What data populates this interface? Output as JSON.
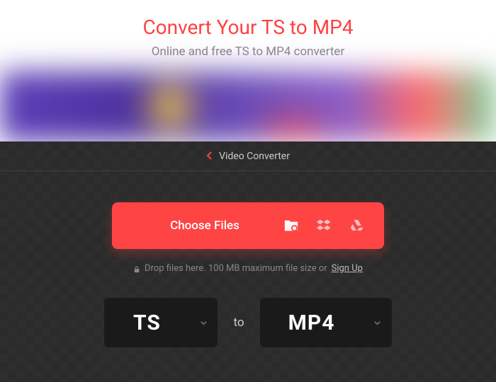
{
  "header": {
    "title": "Convert Your TS to MP4",
    "subtitle": "Online and free TS to MP4 converter"
  },
  "topbar": {
    "label": "Video Converter"
  },
  "upload": {
    "button_label": "Choose Files",
    "hint_pre": "Drop files here. 100 MB maximum file size or",
    "signup": "Sign Up"
  },
  "formats": {
    "from": "TS",
    "to_label": "to",
    "to": "MP4"
  },
  "colors": {
    "accent": "#ff4444"
  }
}
